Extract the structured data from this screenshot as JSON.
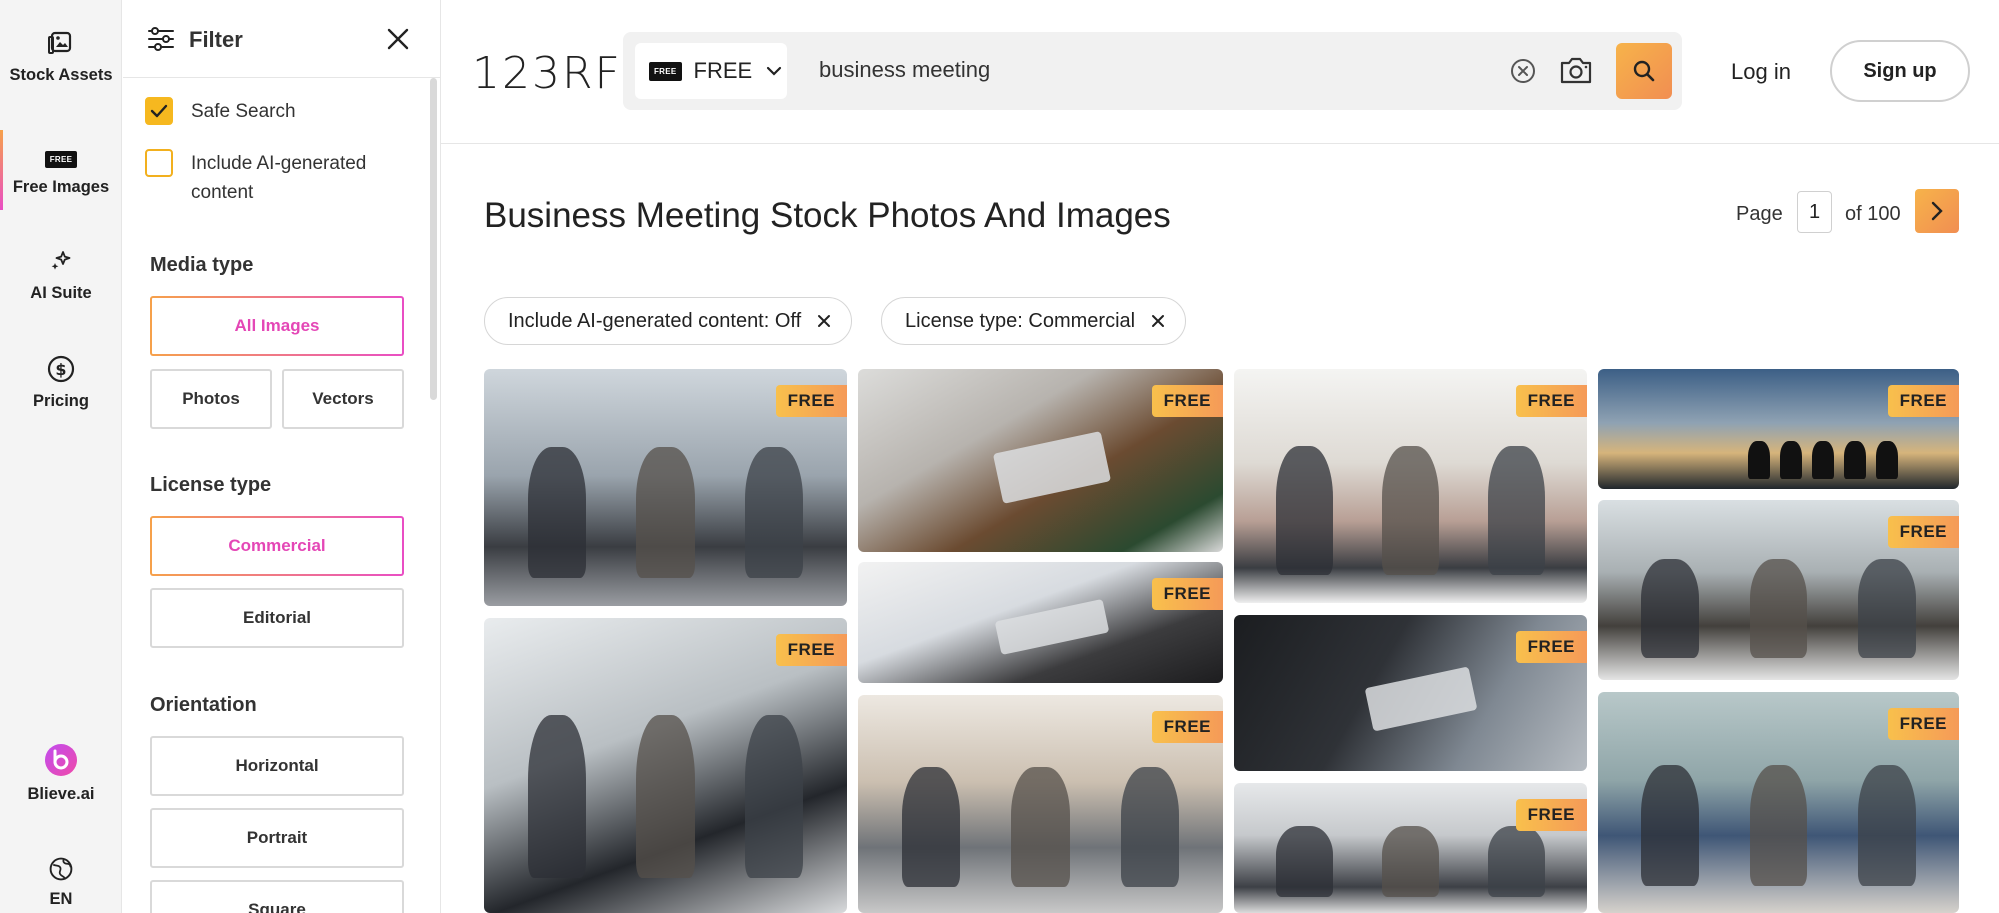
{
  "rail": {
    "items": [
      {
        "label": "Stock Assets",
        "icon": "stock-assets-icon"
      },
      {
        "label": "Free Images",
        "icon": "free-badge-icon",
        "badge": "FREE"
      },
      {
        "label": "AI Suite",
        "icon": "sparkle-icon"
      },
      {
        "label": "Pricing",
        "icon": "dollar-icon"
      },
      {
        "label": "Blieve.ai",
        "icon": "blieve-logo-icon"
      },
      {
        "label": "EN",
        "icon": "globe-icon"
      }
    ]
  },
  "filter": {
    "title": "Filter",
    "safe_search": {
      "label": "Safe Search",
      "checked": true
    },
    "ai_content": {
      "label": "Include AI-generated content",
      "checked": false
    },
    "media_type": {
      "title": "Media type",
      "options": [
        "All Images",
        "Photos",
        "Vectors"
      ],
      "selected": "All Images"
    },
    "license_type": {
      "title": "License type",
      "options": [
        "Commercial",
        "Editorial"
      ],
      "selected": "Commercial"
    },
    "orientation": {
      "title": "Orientation",
      "options": [
        "Horizontal",
        "Portrait",
        "Square"
      ]
    }
  },
  "header": {
    "logo": "123RF",
    "free_selector": {
      "badge": "FREE",
      "label": "FREE"
    },
    "search": {
      "value": "business meeting",
      "placeholder": "Search"
    },
    "login": "Log in",
    "signup": "Sign up"
  },
  "main": {
    "title": "Business Meeting Stock Photos And Images",
    "pager": {
      "label": "Page",
      "current": "1",
      "of": "of 100"
    },
    "chips": [
      "Include AI-generated content: Off",
      "License type: Commercial"
    ],
    "badge": "FREE"
  },
  "colors": {
    "accent_orange": "#f6a14a",
    "accent_pink": "#e94ec4",
    "checkbox": "#f6b81f"
  }
}
